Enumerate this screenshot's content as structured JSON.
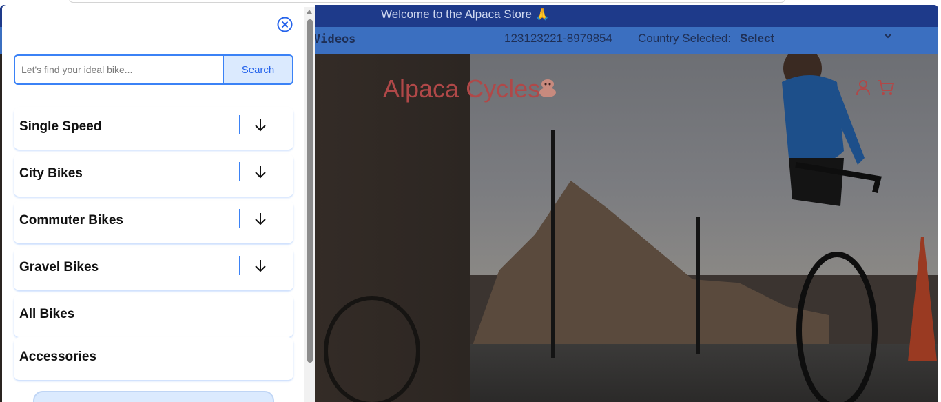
{
  "header": {
    "welcome_text": "Welcome to the Alpaca Store 🙏",
    "nav_videos": "Videos",
    "phone": "123123221-8979854",
    "country_label": "Country Selected:",
    "country_value": "Select"
  },
  "brand": {
    "name": "Alpaca Cycles"
  },
  "drawer": {
    "search": {
      "placeholder": "Let's find your ideal bike...",
      "value": "",
      "button_label": "Search"
    },
    "menu": [
      {
        "label": "Single Speed",
        "expandable": true
      },
      {
        "label": "City Bikes",
        "expandable": true
      },
      {
        "label": "Commuter Bikes",
        "expandable": true
      },
      {
        "label": "Gravel Bikes",
        "expandable": true
      },
      {
        "label": "All Bikes",
        "expandable": false
      },
      {
        "label": "Accessories",
        "expandable": false
      }
    ]
  },
  "colors": {
    "accent": "#3b82f6",
    "topbar": "#1e3a8a",
    "navbar": "#3b6fc0",
    "brand": "#b04848"
  },
  "icons": {
    "close": "close-circle-icon",
    "expand": "arrow-down-icon",
    "user": "user-icon",
    "cart": "cart-icon",
    "logo": "alpaca-logo-icon"
  }
}
